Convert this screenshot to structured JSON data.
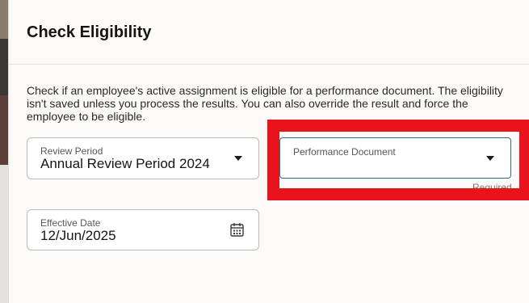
{
  "dialog": {
    "title": "Check Eligibility",
    "description": "Check if an employee's active assignment is eligible for a performance document. The eligibility isn't saved unless you process the results. You can also override the result and force the employee to be eligible."
  },
  "form": {
    "review_period": {
      "label": "Review Period",
      "value": "Annual Review Period 2024"
    },
    "performance_document": {
      "label": "Performance Document",
      "value": "",
      "required_text": "Required"
    },
    "effective_date": {
      "label": "Effective Date",
      "value": "12/Jun/2025"
    }
  },
  "icons": {
    "review_dropdown": "chevron-down-icon",
    "performance_dropdown": "chevron-down-icon",
    "date_picker": "calendar-icon"
  },
  "colors": {
    "highlight": "#e8131b",
    "focus_border": "#2d6a8f"
  }
}
